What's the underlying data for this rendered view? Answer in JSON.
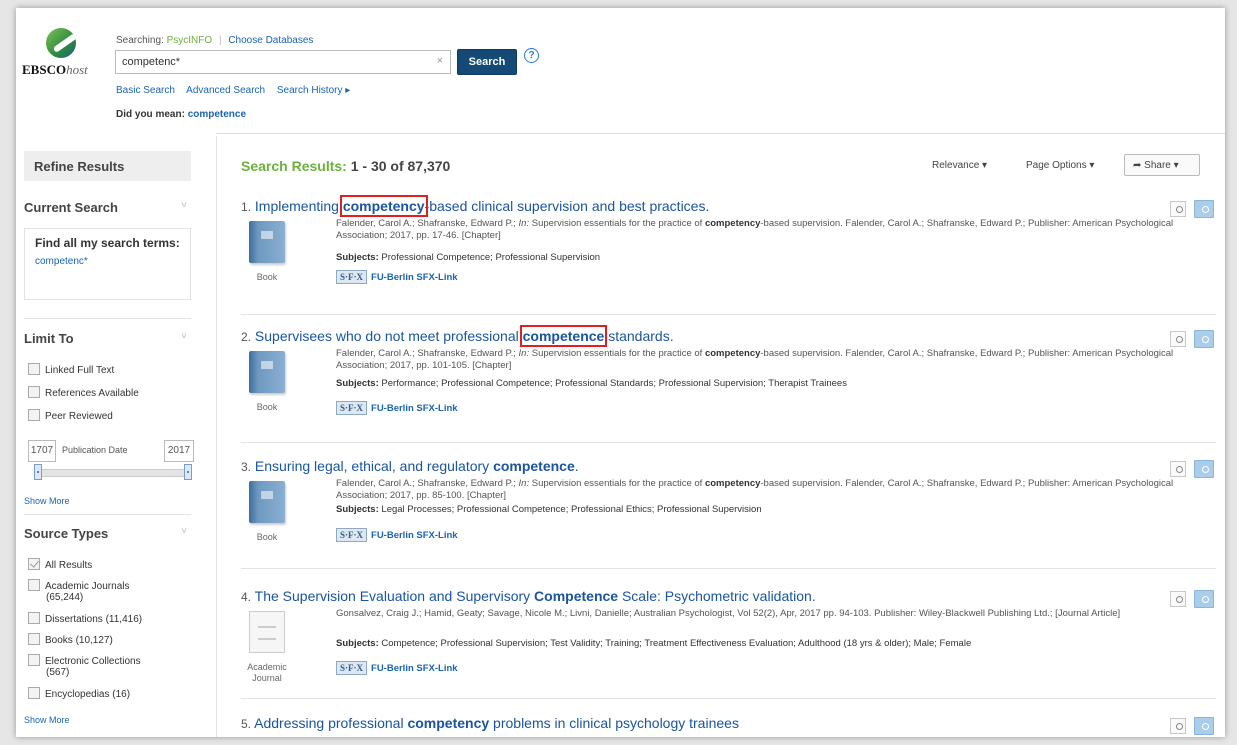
{
  "brand": {
    "logo_text": "EBSCO",
    "logo_suffix": "host"
  },
  "search": {
    "searching_label": "Searching:",
    "database": "PsycINFO",
    "choose_databases": "Choose Databases",
    "query": "competenc*",
    "clear": "×",
    "button": "Search",
    "help": "?",
    "links": [
      "Basic Search",
      "Advanced Search",
      "Search History ▸"
    ],
    "did_you_mean_label": "Did you mean:",
    "did_you_mean": "competence"
  },
  "sidebar": {
    "refine": "Refine Results",
    "current_search": "Current Search",
    "find_all": "Find all my search terms:",
    "current_term": "competenc*",
    "limit_to": "Limit To",
    "limits": [
      "Linked Full Text",
      "References Available",
      "Peer Reviewed"
    ],
    "date_from": "1707",
    "date_label": "Publication Date",
    "date_to": "2017",
    "show_more": "Show More",
    "source_types": "Source Types",
    "sources": [
      {
        "label": "All Results",
        "count": "",
        "checked": true
      },
      {
        "label": "Academic Journals",
        "count": "(65,244)",
        "checked": false
      },
      {
        "label": "Dissertations (11,416)",
        "count": "",
        "checked": false
      },
      {
        "label": "Books (10,127)",
        "count": "",
        "checked": false
      },
      {
        "label": "Electronic Collections",
        "count": "(567)",
        "checked": false
      },
      {
        "label": "Encyclopedias (16)",
        "count": "",
        "checked": false
      }
    ],
    "show_more2": "Show More",
    "chevron": "˅"
  },
  "results_header": {
    "label": "Search Results:",
    "range": "1 - 30 of 87,370",
    "relevance": "Relevance ▾",
    "page_options": "Page Options ▾",
    "share": "➦ Share ▾"
  },
  "results": [
    {
      "num": "1.",
      "title_pre": "Implementing ",
      "title_hl": "competency",
      "title_post": "-based clinical supervision and best practices.",
      "meta_html": "Falender, Carol A.; Shafranske, Edward P.; <i>In:</i> Supervision essentials for the practice of <b>competency</b>-based supervision. Falender, Carol A.; Shafranske, Edward P.; Publisher: American Psychological Association; 2017, pp. 17-46. [Chapter]",
      "subjects_label": "Subjects:",
      "subjects": " Professional Competence; Professional Supervision",
      "type": "Book",
      "sfx": "FU-Berlin SFX-Link",
      "boxed": true
    },
    {
      "num": "2.",
      "title_pre": "Supervisees who do not meet professional ",
      "title_hl": "competence",
      "title_post": " standards.",
      "meta_html": "Falender, Carol A.; Shafranske, Edward P.; <i>In:</i> Supervision essentials for the practice of <b>competency</b>-based supervision. Falender, Carol A.; Shafranske, Edward P.; Publisher: American Psychological Association; 2017, pp. 101-105. [Chapter]",
      "subjects_label": "Subjects:",
      "subjects": " Performance; Professional Competence; Professional Standards; Professional Supervision; Therapist Trainees",
      "type": "Book",
      "sfx": "FU-Berlin SFX-Link",
      "boxed": true
    },
    {
      "num": "3.",
      "title_pre": "Ensuring legal, ethical, and regulatory ",
      "title_hl": "competence",
      "title_post": ".",
      "meta_html": "Falender, Carol A.; Shafranske, Edward P.; <i>In:</i> Supervision essentials for the practice of <b>competency</b>-based supervision. Falender, Carol A.; Shafranske, Edward P.; Publisher: American Psychological Association; 2017, pp. 85-100. [Chapter]",
      "subjects_label": "Subjects:",
      "subjects": " Legal Processes; Professional Competence; Professional Ethics; Professional Supervision",
      "type": "Book",
      "sfx": "FU-Berlin SFX-Link",
      "boxed": false
    },
    {
      "num": "4.",
      "title_pre": "The Supervision Evaluation and Supervisory ",
      "title_hl": "Competence",
      "title_post": " Scale: Psychometric validation.",
      "meta_html": "Gonsalvez, Craig J.; Hamid, Geaty; Savage, Nicole M.; Livni, Danielle; Australian Psychologist, Vol 52(2), Apr, 2017 pp. 94-103. Publisher: Wiley-Blackwell Publishing Ltd.; [Journal Article]",
      "subjects_label": "Subjects:",
      "subjects": " Competence; Professional Supervision; Test Validity; Training; Treatment Effectiveness Evaluation; Adulthood (18 yrs & older); Male; Female",
      "type": "Academic Journal",
      "sfx": "FU-Berlin SFX-Link",
      "boxed": false
    },
    {
      "num": "5.",
      "title_pre": "Addressing professional ",
      "title_hl": "competency",
      "title_post": " problems in clinical psychology trainees",
      "meta_html": "",
      "subjects_label": "",
      "subjects": "",
      "type": "",
      "sfx": "",
      "boxed": false
    }
  ],
  "sfx_logo": "S·F·X"
}
